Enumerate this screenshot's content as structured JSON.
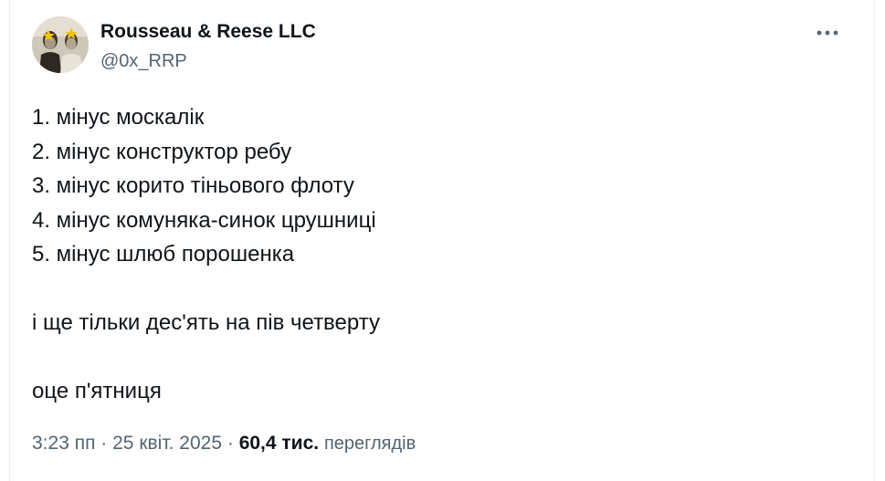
{
  "author": {
    "display_name": "Rousseau & Reese LLC",
    "handle": "@0x_RRP",
    "avatar_icon": "vintage-photo-avatar"
  },
  "menu": {
    "more_icon": "more-horizontal-icon",
    "more_glyph": "•••"
  },
  "tweet": {
    "lines": [
      "1. мінус москалік",
      "2. мінус конструктор ребу",
      "3. мінус корито тіньового флоту",
      "4. мінус комуняка-синок црушниці",
      "5. мінус шлюб порошенка"
    ],
    "paragraph_2": "і ще тільки дес'ять на пів четверту",
    "paragraph_3": "оце п'ятниця"
  },
  "meta": {
    "time": "3:23 пп",
    "separator": " · ",
    "date": "25 квіт. 2025",
    "views_count": "60,4 тис.",
    "views_label": "переглядів"
  },
  "colors": {
    "text_primary": "#0f1419",
    "text_secondary": "#536471",
    "border": "#e6ecf0"
  }
}
